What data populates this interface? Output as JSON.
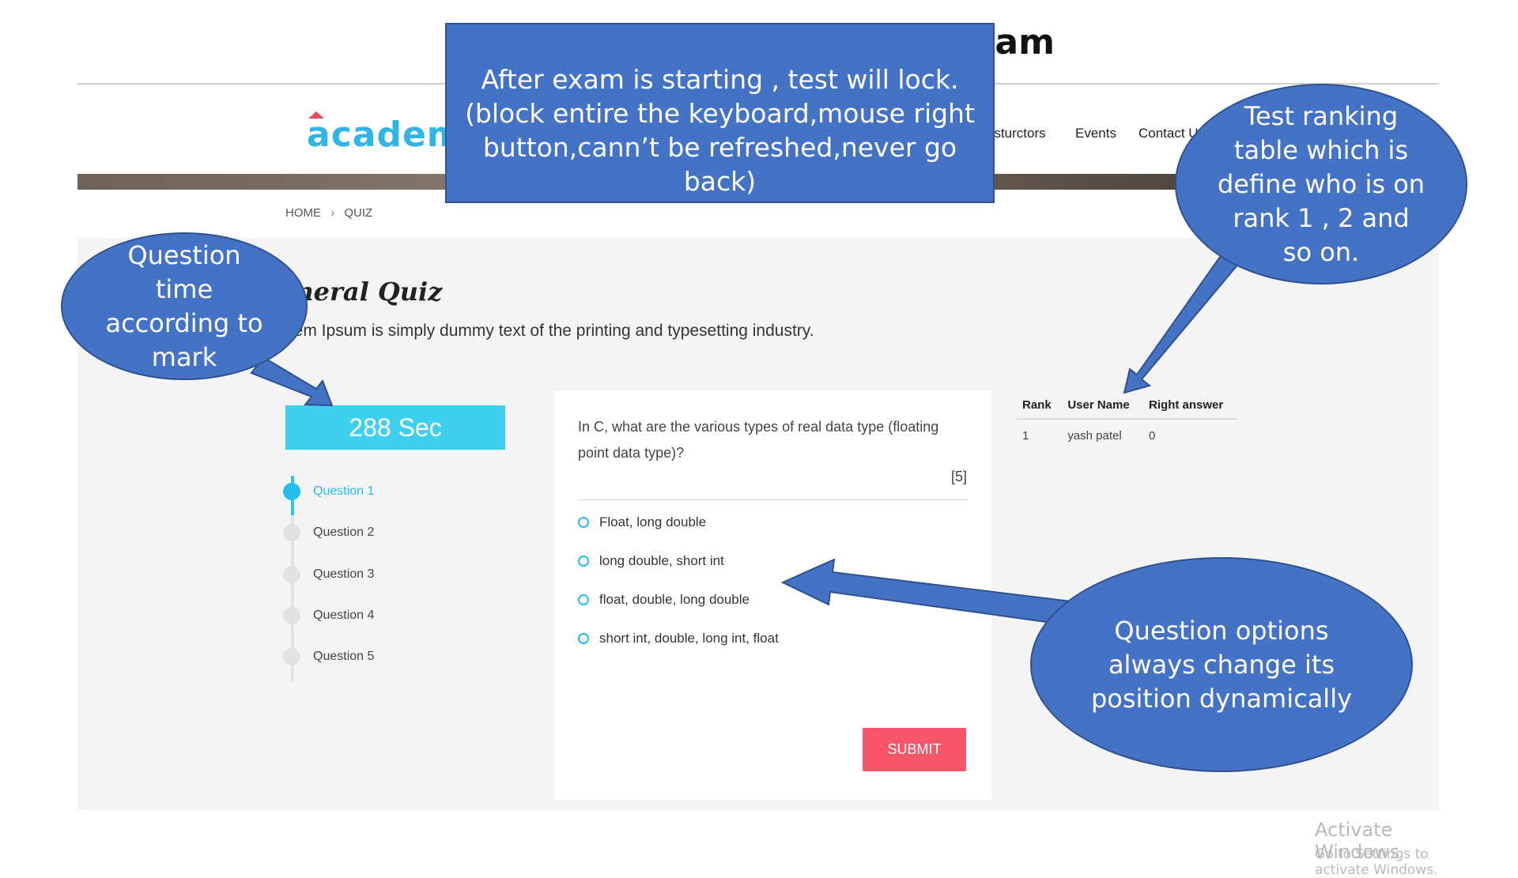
{
  "slide": {
    "title": "xam"
  },
  "header": {
    "logo": "academy",
    "nav": [
      "nsturctors",
      "Events",
      "Contact U"
    ]
  },
  "breadcrumb": {
    "home": "HOME",
    "separator": "›",
    "current": "QUIZ"
  },
  "quiz": {
    "title": "eneral Quiz",
    "description": "orem Ipsum is simply dummy text of the printing and typesetting industry."
  },
  "timer": {
    "label": "288 Sec"
  },
  "steps": [
    {
      "label": "Question 1",
      "active": true
    },
    {
      "label": "Question 2",
      "active": false
    },
    {
      "label": "Question 3",
      "active": false
    },
    {
      "label": "Question 4",
      "active": false
    },
    {
      "label": "Question 5",
      "active": false
    }
  ],
  "question": {
    "text": "In C, what are the various types of real data type (floating point data type)?",
    "marks": "[5]",
    "options": [
      "Float, long double",
      "long double, short int",
      "float, double, long double",
      "short int, double, long int, float"
    ],
    "submit_label": "SUBMIT"
  },
  "rank_table": {
    "headers": [
      "Rank",
      "User Name",
      "Right answer"
    ],
    "rows": [
      [
        "1",
        "yash patel",
        "0"
      ]
    ]
  },
  "callouts": {
    "lock": "After exam is starting  ,  test will lock.(block entire the keyboard,mouse right button,cann’t be refreshed,never go back)",
    "timer": "Question time according to mark",
    "ranking": "Test ranking table which is define who is on rank 1 , 2 and so on.",
    "options": "Question options always change its position dynamically"
  },
  "watermark": {
    "line1": "Activate Windows",
    "line2": "Go to Settings to activate Windows."
  },
  "colors": {
    "callout_blue": "#4472c4",
    "accent_cyan": "#2cc3ee",
    "submit_red": "#f7566a"
  }
}
